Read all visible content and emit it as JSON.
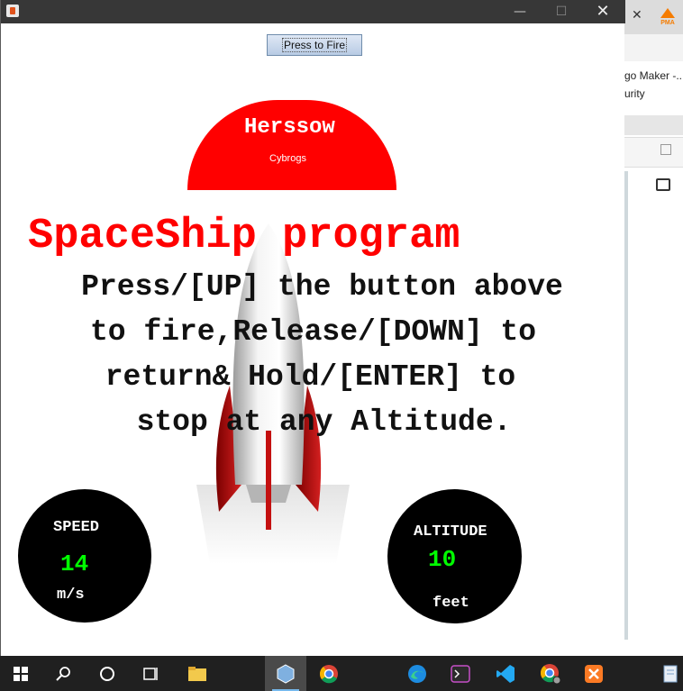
{
  "window": {
    "minimize": "—",
    "maximize": "☐",
    "close": "✕"
  },
  "fire_button": "Press to Fire",
  "header": {
    "name": "Herssow",
    "team": "Cybrogs"
  },
  "headline": "SpaceShip program",
  "instructions": [
    "Press/[UP] the button above",
    "to fire,Release/[DOWN] to",
    "return& Hold/[ENTER] to",
    "stop at any Altitude."
  ],
  "speed": {
    "label": "SPEED",
    "value": "14",
    "unit": "m/s"
  },
  "altitude": {
    "label": "ALTITUDE",
    "value": "10",
    "unit": "feet"
  },
  "background_app": {
    "close_tab": "✕",
    "pma_badge": "PMA",
    "tab_text": "go Maker -..",
    "side_text": "urity"
  },
  "colors": {
    "accent": "#ff0000",
    "gauge_value": "#00ff00",
    "titlebar": "#373737",
    "taskbar": "#202020"
  },
  "taskbar_icons": [
    "windows-start-icon",
    "search-icon",
    "cortana-icon",
    "task-view-icon",
    "file-explorer-icon",
    "virtualbox-icon",
    "chrome-icon",
    "edge-icon",
    "terminal-icon",
    "vscode-icon",
    "chrome-profile-icon",
    "xampp-icon",
    "notepad-icon"
  ]
}
